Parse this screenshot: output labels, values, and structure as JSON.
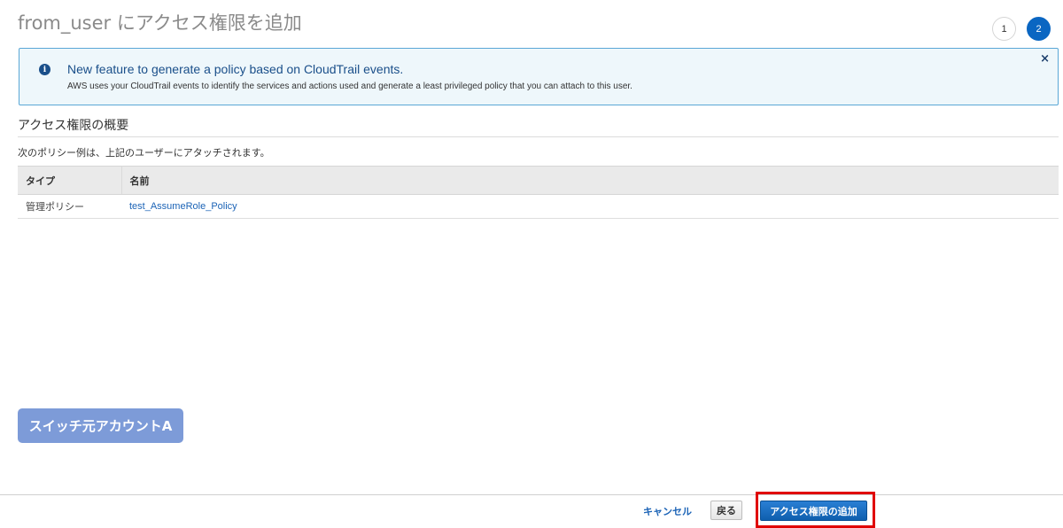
{
  "page": {
    "title": "from_user にアクセス権限を追加"
  },
  "steps": [
    {
      "label": "1",
      "active": false
    },
    {
      "label": "2",
      "active": true
    }
  ],
  "notice": {
    "icon": "info-icon",
    "title": "New feature to generate a policy based on CloudTrail events.",
    "body": "AWS uses your CloudTrail events to identify the services and actions used and generate a least privileged policy that you can attach to this user.",
    "close_label": "×"
  },
  "summary": {
    "heading": "アクセス権限の概要",
    "description": "次のポリシー例は、上記のユーザーにアタッチされます。",
    "columns": [
      "タイプ",
      "名前"
    ],
    "rows": [
      {
        "type": "管理ポリシー",
        "name": "test_AssumeRole_Policy"
      }
    ]
  },
  "account_badge": {
    "label": "スイッチ元アカウントA"
  },
  "footer": {
    "cancel_label": "キャンセル",
    "back_label": "戻る",
    "submit_label": "アクセス権限の追加"
  },
  "colors": {
    "primary": "#0a66c2",
    "link": "#1b63b6",
    "highlight": "#e00000",
    "badge": "#7d9bd8"
  }
}
